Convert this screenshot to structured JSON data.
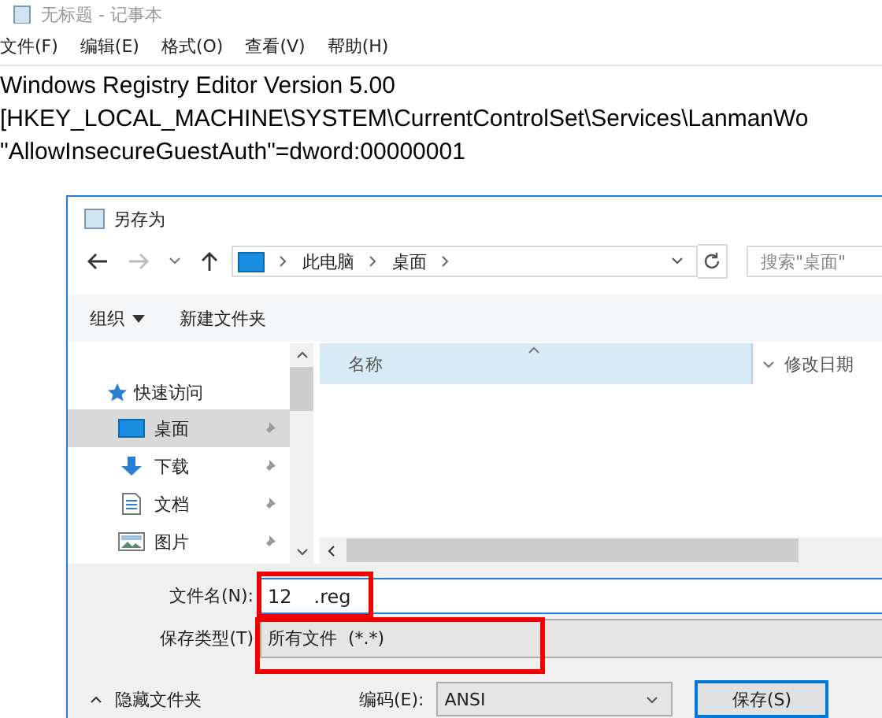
{
  "notepad": {
    "title": "无标题 - 记事本",
    "menu": [
      "文件(F)",
      "编辑(E)",
      "格式(O)",
      "查看(V)",
      "帮助(H)"
    ],
    "lines": [
      "Windows Registry Editor Version 5.00",
      "[HKEY_LOCAL_MACHINE\\SYSTEM\\CurrentControlSet\\Services\\LanmanWo",
      "\"AllowInsecureGuestAuth\"=dword:00000001"
    ]
  },
  "dialog": {
    "title": "另存为",
    "breadcrumb": [
      "此电脑",
      "桌面"
    ],
    "search": {
      "placeholder": "搜索\"桌面\""
    },
    "toolbar": [
      {
        "label": "组织",
        "kind": "menu"
      },
      {
        "label": "新建文件夹",
        "kind": "plain"
      }
    ],
    "nav_header": "快速访问",
    "nav_items": [
      {
        "label": "桌面",
        "kind": "desktop",
        "selected": true
      },
      {
        "label": "下载",
        "kind": "download",
        "selected": false
      },
      {
        "label": "文档",
        "kind": "document",
        "selected": false
      },
      {
        "label": "图片",
        "kind": "picture",
        "selected": false
      }
    ],
    "columns": [
      "名称",
      "修改日期"
    ],
    "filename": {
      "label": "文件名(N):",
      "value_start": "12",
      "value_end": ".reg",
      "highlighted": true
    },
    "file_type": {
      "label": "保存类型(T)",
      "value": "所有文件  (*.*)",
      "highlighted": true
    },
    "hide_folders": "隐藏文件夹",
    "encoding": {
      "label": "编码(E):",
      "value": "ANSI"
    },
    "save_button": "保存(S)"
  }
}
